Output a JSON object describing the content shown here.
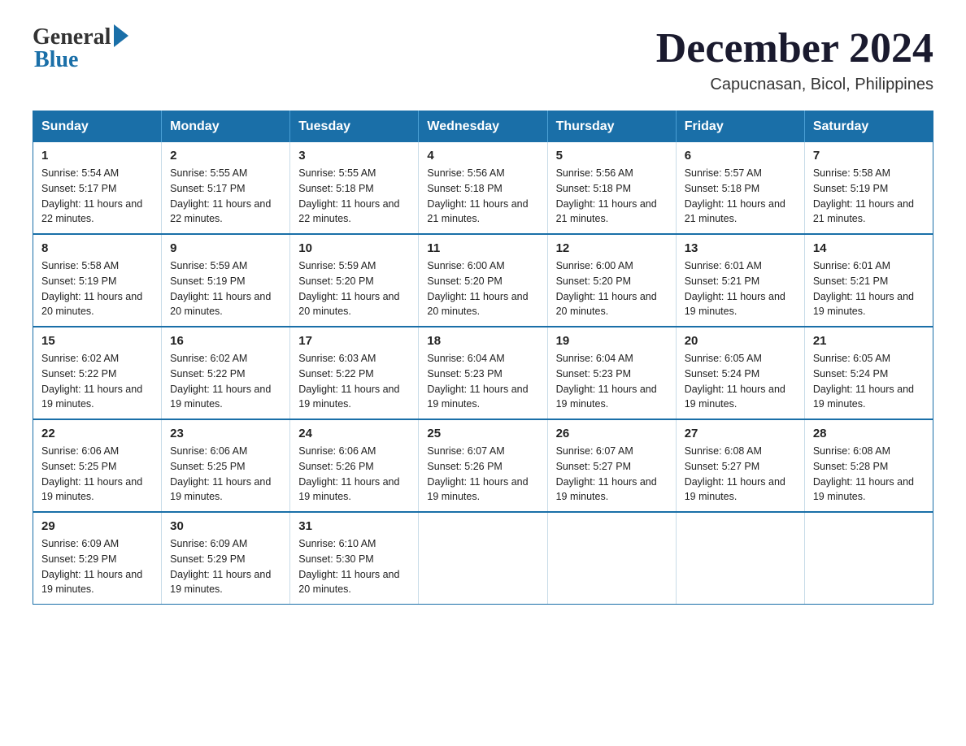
{
  "logo": {
    "general": "General",
    "blue": "Blue"
  },
  "title": {
    "month": "December 2024",
    "location": "Capucnasan, Bicol, Philippines"
  },
  "days_header": [
    "Sunday",
    "Monday",
    "Tuesday",
    "Wednesday",
    "Thursday",
    "Friday",
    "Saturday"
  ],
  "weeks": [
    [
      {
        "day": "1",
        "sunrise": "5:54 AM",
        "sunset": "5:17 PM",
        "daylight": "11 hours and 22 minutes."
      },
      {
        "day": "2",
        "sunrise": "5:55 AM",
        "sunset": "5:17 PM",
        "daylight": "11 hours and 22 minutes."
      },
      {
        "day": "3",
        "sunrise": "5:55 AM",
        "sunset": "5:18 PM",
        "daylight": "11 hours and 22 minutes."
      },
      {
        "day": "4",
        "sunrise": "5:56 AM",
        "sunset": "5:18 PM",
        "daylight": "11 hours and 21 minutes."
      },
      {
        "day": "5",
        "sunrise": "5:56 AM",
        "sunset": "5:18 PM",
        "daylight": "11 hours and 21 minutes."
      },
      {
        "day": "6",
        "sunrise": "5:57 AM",
        "sunset": "5:18 PM",
        "daylight": "11 hours and 21 minutes."
      },
      {
        "day": "7",
        "sunrise": "5:58 AM",
        "sunset": "5:19 PM",
        "daylight": "11 hours and 21 minutes."
      }
    ],
    [
      {
        "day": "8",
        "sunrise": "5:58 AM",
        "sunset": "5:19 PM",
        "daylight": "11 hours and 20 minutes."
      },
      {
        "day": "9",
        "sunrise": "5:59 AM",
        "sunset": "5:19 PM",
        "daylight": "11 hours and 20 minutes."
      },
      {
        "day": "10",
        "sunrise": "5:59 AM",
        "sunset": "5:20 PM",
        "daylight": "11 hours and 20 minutes."
      },
      {
        "day": "11",
        "sunrise": "6:00 AM",
        "sunset": "5:20 PM",
        "daylight": "11 hours and 20 minutes."
      },
      {
        "day": "12",
        "sunrise": "6:00 AM",
        "sunset": "5:20 PM",
        "daylight": "11 hours and 20 minutes."
      },
      {
        "day": "13",
        "sunrise": "6:01 AM",
        "sunset": "5:21 PM",
        "daylight": "11 hours and 19 minutes."
      },
      {
        "day": "14",
        "sunrise": "6:01 AM",
        "sunset": "5:21 PM",
        "daylight": "11 hours and 19 minutes."
      }
    ],
    [
      {
        "day": "15",
        "sunrise": "6:02 AM",
        "sunset": "5:22 PM",
        "daylight": "11 hours and 19 minutes."
      },
      {
        "day": "16",
        "sunrise": "6:02 AM",
        "sunset": "5:22 PM",
        "daylight": "11 hours and 19 minutes."
      },
      {
        "day": "17",
        "sunrise": "6:03 AM",
        "sunset": "5:22 PM",
        "daylight": "11 hours and 19 minutes."
      },
      {
        "day": "18",
        "sunrise": "6:04 AM",
        "sunset": "5:23 PM",
        "daylight": "11 hours and 19 minutes."
      },
      {
        "day": "19",
        "sunrise": "6:04 AM",
        "sunset": "5:23 PM",
        "daylight": "11 hours and 19 minutes."
      },
      {
        "day": "20",
        "sunrise": "6:05 AM",
        "sunset": "5:24 PM",
        "daylight": "11 hours and 19 minutes."
      },
      {
        "day": "21",
        "sunrise": "6:05 AM",
        "sunset": "5:24 PM",
        "daylight": "11 hours and 19 minutes."
      }
    ],
    [
      {
        "day": "22",
        "sunrise": "6:06 AM",
        "sunset": "5:25 PM",
        "daylight": "11 hours and 19 minutes."
      },
      {
        "day": "23",
        "sunrise": "6:06 AM",
        "sunset": "5:25 PM",
        "daylight": "11 hours and 19 minutes."
      },
      {
        "day": "24",
        "sunrise": "6:06 AM",
        "sunset": "5:26 PM",
        "daylight": "11 hours and 19 minutes."
      },
      {
        "day": "25",
        "sunrise": "6:07 AM",
        "sunset": "5:26 PM",
        "daylight": "11 hours and 19 minutes."
      },
      {
        "day": "26",
        "sunrise": "6:07 AM",
        "sunset": "5:27 PM",
        "daylight": "11 hours and 19 minutes."
      },
      {
        "day": "27",
        "sunrise": "6:08 AM",
        "sunset": "5:27 PM",
        "daylight": "11 hours and 19 minutes."
      },
      {
        "day": "28",
        "sunrise": "6:08 AM",
        "sunset": "5:28 PM",
        "daylight": "11 hours and 19 minutes."
      }
    ],
    [
      {
        "day": "29",
        "sunrise": "6:09 AM",
        "sunset": "5:29 PM",
        "daylight": "11 hours and 19 minutes."
      },
      {
        "day": "30",
        "sunrise": "6:09 AM",
        "sunset": "5:29 PM",
        "daylight": "11 hours and 19 minutes."
      },
      {
        "day": "31",
        "sunrise": "6:10 AM",
        "sunset": "5:30 PM",
        "daylight": "11 hours and 20 minutes."
      },
      null,
      null,
      null,
      null
    ]
  ]
}
